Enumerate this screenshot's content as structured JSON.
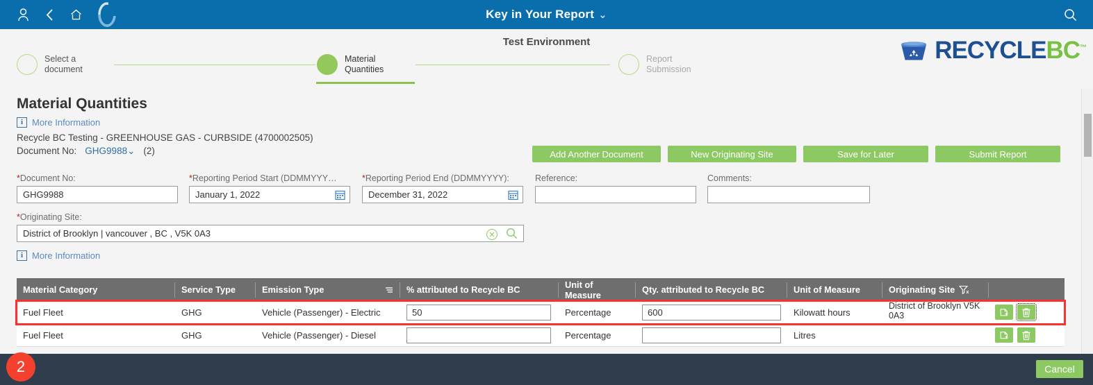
{
  "topbar": {
    "icons": [
      "user-icon",
      "back-icon",
      "home-icon",
      "company-logo-icon"
    ],
    "title": "Key in Your Report",
    "caret": "⌄",
    "search_icon": "search-icon"
  },
  "environment": {
    "title": "Test Environment"
  },
  "brand": {
    "name_primary": "RECYCLE",
    "name_secondary": "BC",
    "tm": "™"
  },
  "steps": [
    {
      "label_line1": "Select a",
      "label_line2": "document",
      "state": "done"
    },
    {
      "label_line1": "Material",
      "label_line2": "Quantities",
      "state": "active"
    },
    {
      "label_line1": "Report",
      "label_line2": "Submission",
      "state": "pending"
    }
  ],
  "page": {
    "title": "Material Quantities",
    "more_information_label": "More Information",
    "document_description": "Recycle BC Testing - GREENHOUSE GAS - CURBSIDE (4700002505)",
    "document_no_label": "Document No:",
    "document_no_value": "GHG9988",
    "document_no_count": "(2)"
  },
  "actions": {
    "add_another_document": "Add Another Document",
    "new_originating_site": "New Originating Site",
    "save_for_later": "Save for Later",
    "submit_report": "Submit Report"
  },
  "form": {
    "document_no": {
      "label": "Document No:",
      "required": true,
      "value": "GHG9988",
      "placeholder": ""
    },
    "reporting_period_start": {
      "label": "Reporting Period Start (DDMMYYY…",
      "required": true,
      "value": "January 1, 2022",
      "placeholder": ""
    },
    "reporting_period_end": {
      "label": "Reporting Period End (DDMMYYYY):",
      "required": true,
      "value": "December 31, 2022",
      "placeholder": ""
    },
    "reference": {
      "label": "Reference:",
      "required": false,
      "value": "",
      "placeholder": ""
    },
    "comments": {
      "label": "Comments:",
      "required": false,
      "value": "",
      "placeholder": ""
    },
    "originating_site": {
      "label": "Originating Site:",
      "required": true,
      "value": "District of Brooklyn | vancouver , BC , V5K 0A3",
      "placeholder": ""
    }
  },
  "table": {
    "headers": [
      "Material Category",
      "Service Type",
      "Emission Type",
      "% attributed to Recycle BC",
      "Unit of Measure",
      "Qty. attributed to Recycle BC",
      "Unit of Measure",
      "Originating Site",
      ""
    ],
    "rows": [
      {
        "material_category": "Fuel Fleet",
        "service_type": "GHG",
        "emission_type": "Vehicle (Passenger) - Electric",
        "pct_attributed": "50",
        "unit_of_measure_1": "Percentage",
        "qty_attributed": "600",
        "unit_of_measure_2": "Kilowatt hours",
        "originating_site": "District of Brooklyn V5K 0A3",
        "highlighted": true
      },
      {
        "material_category": "Fuel Fleet",
        "service_type": "GHG",
        "emission_type": "Vehicle (Passenger) - Diesel",
        "pct_attributed": "",
        "unit_of_measure_1": "Percentage",
        "qty_attributed": "",
        "unit_of_measure_2": "Litres",
        "originating_site": "",
        "highlighted": false
      }
    ]
  },
  "footer": {
    "cancel_label": "Cancel"
  },
  "annotation": {
    "badge_number": "2"
  },
  "colors": {
    "topbar_blue": "#0a6ead",
    "green_button": "#8dc963",
    "step_active": "#93c85a",
    "footer_dark": "#2f3d4c",
    "highlight_red": "#ff2f2f",
    "badge_red": "#f4402e",
    "table_header_gray": "#6e6e6e"
  }
}
